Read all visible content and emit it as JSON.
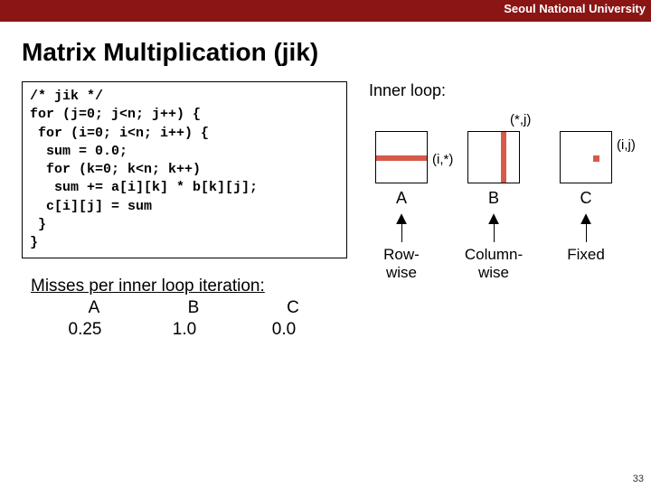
{
  "header": {
    "affiliation": "Seoul National University"
  },
  "title": "Matrix Multiplication (jik)",
  "code": "/* jik */\nfor (j=0; j<n; j++) {\n for (i=0; i<n; i++) {\n  sum = 0.0;\n  for (k=0; k<n; k++)\n   sum += a[i][k] * b[k][j];\n  c[i][j] = sum\n }\n}",
  "misses": {
    "title": "Misses per inner loop iteration:",
    "cols": [
      {
        "name": "A",
        "value": "0.25"
      },
      {
        "name": "B",
        "value": "1.0"
      },
      {
        "name": "C",
        "value": "0.0"
      }
    ]
  },
  "inner_loop": {
    "label": "Inner loop:",
    "matrices": [
      {
        "letter": "A",
        "coord": "(i,*)",
        "access": "Row-wise"
      },
      {
        "letter": "B",
        "coord": "(*,j)",
        "access": "Column-\nwise"
      },
      {
        "letter": "C",
        "coord": "(i,j)",
        "access": "Fixed"
      }
    ]
  },
  "page_number": "33"
}
